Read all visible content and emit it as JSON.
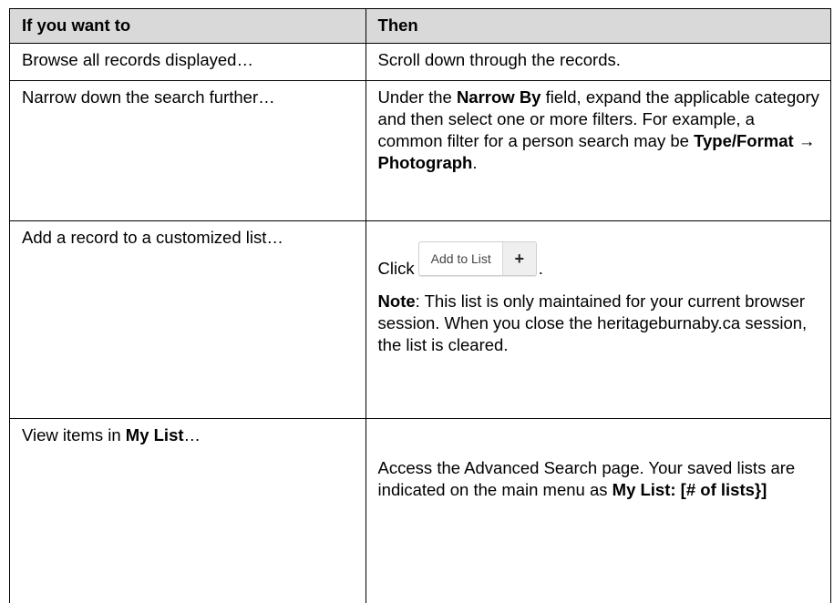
{
  "table": {
    "header": {
      "col1": "If you want to",
      "col2": "Then"
    },
    "rows": [
      {
        "action": "Browse all records displayed…",
        "result": "Scroll down through the records."
      },
      {
        "action": "Narrow down the search further…",
        "result_p1": "Under the ",
        "result_b1": "Narrow By",
        "result_p2": " field, expand the applicable category and then select one or more filters. For example, a common filter for a person search may be ",
        "result_b2": "Type/Format → Photograph",
        "result_p3": "."
      },
      {
        "action": "Add a record to a customized list…",
        "click_text": "Click",
        "button_label": "Add to List",
        "button_icon": "+",
        "click_suffix": ".",
        "note_label": "Note",
        "note_text": ": This list is only maintained for your current browser session. When you close the heritageburnaby.ca session, the list is cleared."
      },
      {
        "action_p1": "View items in ",
        "action_b1": "My List",
        "action_p2": "…",
        "result_p1": "Access the Advanced Search page. Your saved lists are indicated on the main menu as ",
        "result_b1": "My List: [# of lists}]"
      }
    ]
  }
}
